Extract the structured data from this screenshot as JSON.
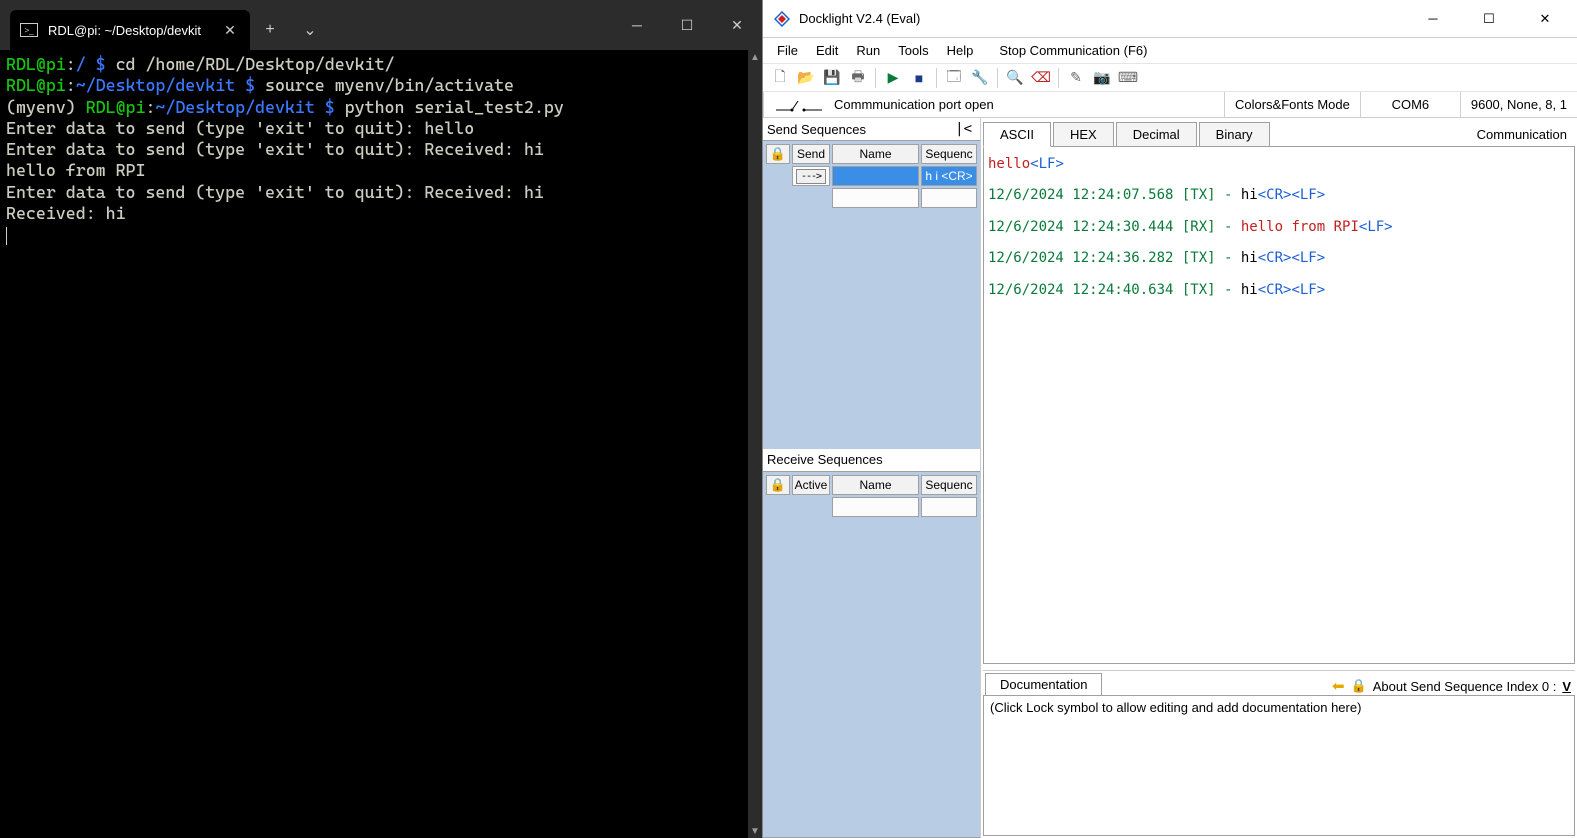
{
  "terminal": {
    "tab_title": "RDL@pi: ~/Desktop/devkit",
    "new_tab_glyph": "+",
    "dropdown_glyph": "⌄",
    "lines": [
      {
        "segments": [
          {
            "text": "RDL@pi",
            "cls": "pr-green"
          },
          {
            "text": ":",
            "cls": "pr-white"
          },
          {
            "text": "/ $",
            "cls": "pr-blue"
          },
          {
            "text": " cd /home/RDL/Desktop/devkit/",
            "cls": "pr-white"
          }
        ]
      },
      {
        "segments": [
          {
            "text": "RDL@pi",
            "cls": "pr-green"
          },
          {
            "text": ":",
            "cls": "pr-white"
          },
          {
            "text": "~/Desktop/devkit $",
            "cls": "pr-blue"
          },
          {
            "text": " source myenv/bin/activate",
            "cls": "pr-white"
          }
        ]
      },
      {
        "segments": [
          {
            "text": "(myenv) ",
            "cls": "pr-white"
          },
          {
            "text": "RDL@pi",
            "cls": "pr-green"
          },
          {
            "text": ":",
            "cls": "pr-white"
          },
          {
            "text": "~/Desktop/devkit $",
            "cls": "pr-blue"
          },
          {
            "text": " python serial_test2.py",
            "cls": "pr-white"
          }
        ]
      },
      {
        "segments": [
          {
            "text": "Enter data to send (type 'exit' to quit): hello",
            "cls": "pr-white"
          }
        ]
      },
      {
        "segments": [
          {
            "text": "Enter data to send (type 'exit' to quit): Received: hi",
            "cls": "pr-white"
          }
        ]
      },
      {
        "segments": [
          {
            "text": "hello from RPI",
            "cls": "pr-white"
          }
        ]
      },
      {
        "segments": [
          {
            "text": "Enter data to send (type 'exit' to quit): Received: hi",
            "cls": "pr-white"
          }
        ]
      },
      {
        "segments": [
          {
            "text": "Received: hi",
            "cls": "pr-white"
          }
        ]
      }
    ]
  },
  "docklight": {
    "title": "Docklight V2.4 (Eval)",
    "menu": [
      "File",
      "Edit",
      "Run",
      "Tools",
      "Help",
      "Stop Communication  (F6)"
    ],
    "status": {
      "comm": "Commmunication port open",
      "mode": "Colors&Fonts Mode",
      "port": "COM6",
      "settings": "9600, None, 8, 1"
    },
    "send_sequences": {
      "title": "Send Sequences",
      "collapse": "|<",
      "headers": {
        "send": "Send",
        "name": "Name",
        "seq": "Sequenc"
      },
      "rows": [
        {
          "send": "--->",
          "name": "",
          "seq": "h i <CR>",
          "selected": true
        }
      ]
    },
    "receive_sequences": {
      "title": "Receive Sequences",
      "headers": {
        "active": "Active",
        "name": "Name",
        "seq": "Sequenc"
      }
    },
    "log_tabs": [
      "ASCII",
      "HEX",
      "Decimal",
      "Binary"
    ],
    "active_tab": "ASCII",
    "comm_label": "Communication",
    "log_lines": [
      [
        {
          "text": "hello",
          "cls": "msg-red"
        },
        {
          "text": "<LF>",
          "cls": "lf-blue"
        }
      ],
      [],
      [
        {
          "text": "12/6/2024 12:24:07.568 [TX] - ",
          "cls": "ts-green"
        },
        {
          "text": "hi",
          "cls": "msg-black"
        },
        {
          "text": "<CR><LF>",
          "cls": "lf-blue"
        }
      ],
      [],
      [
        {
          "text": "12/6/2024 12:24:30.444 [RX] - ",
          "cls": "ts-green"
        },
        {
          "text": "hello from RPI",
          "cls": "msg-red"
        },
        {
          "text": "<LF>",
          "cls": "lf-blue"
        }
      ],
      [],
      [
        {
          "text": "12/6/2024 12:24:36.282 [TX] - ",
          "cls": "ts-green"
        },
        {
          "text": "hi",
          "cls": "msg-black"
        },
        {
          "text": "<CR><LF>",
          "cls": "lf-blue"
        }
      ],
      [],
      [
        {
          "text": "12/6/2024 12:24:40.634 [TX] - ",
          "cls": "ts-green"
        },
        {
          "text": "hi",
          "cls": "msg-black"
        },
        {
          "text": "<CR><LF>",
          "cls": "lf-blue"
        }
      ]
    ],
    "documentation": {
      "tab": "Documentation",
      "about": "About Send Sequence Index 0 :",
      "v": "V",
      "body": "(Click Lock symbol to allow editing and add documentation here)"
    }
  }
}
